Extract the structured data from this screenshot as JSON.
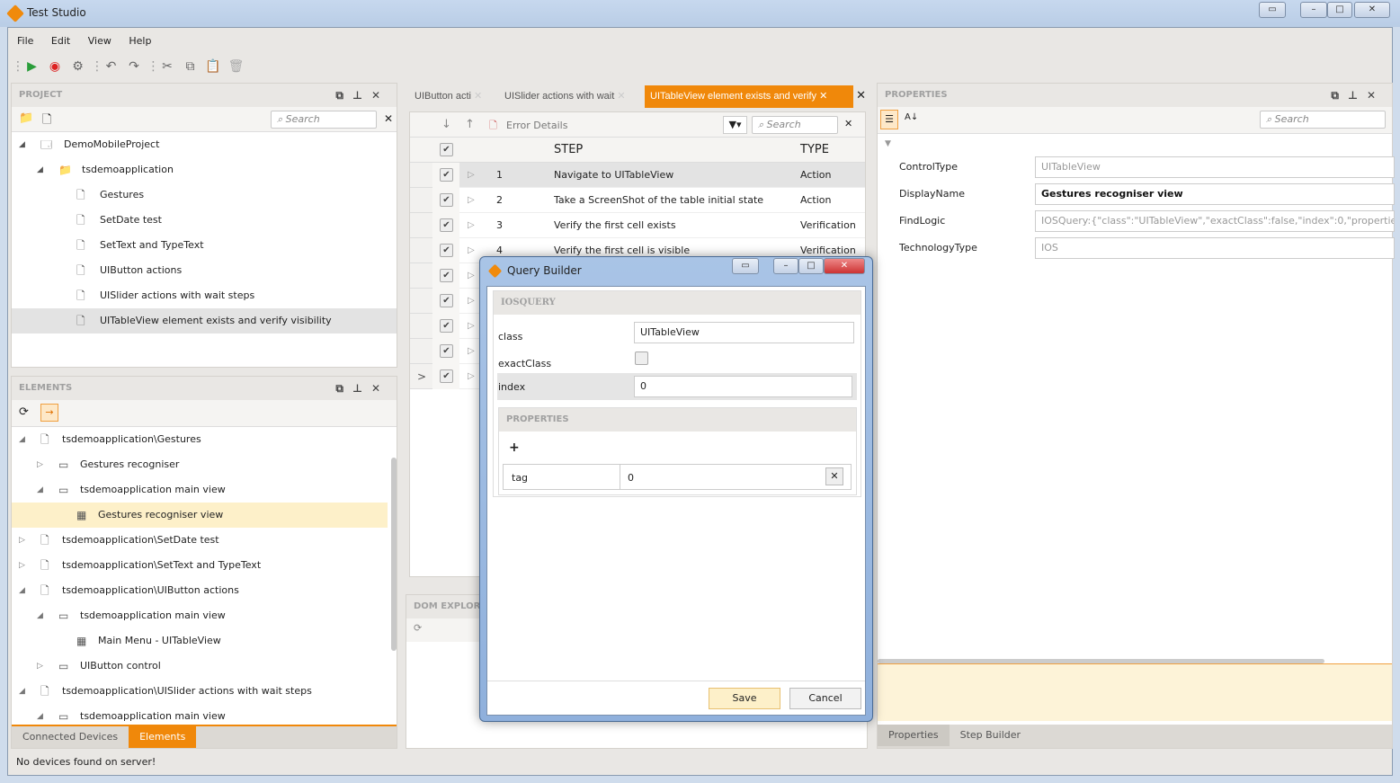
{
  "window": {
    "title": "Test Studio",
    "controls": [
      "restore-down",
      "minimize",
      "maximize",
      "close"
    ]
  },
  "menu": [
    "File",
    "Edit",
    "View",
    "Help"
  ],
  "toolbar": {
    "icons": [
      "run-icon",
      "record-icon",
      "settings-icon",
      "undo-icon",
      "redo-icon",
      "cut-icon",
      "copy-icon",
      "paste-icon",
      "delete-icon"
    ]
  },
  "project": {
    "title": "PROJECT",
    "search_placeholder": "Search",
    "items": [
      {
        "label": "DemoMobileProject",
        "level": 0,
        "icon": "project-icon",
        "expanded": true
      },
      {
        "label": "tsdemoapplication",
        "level": 1,
        "icon": "folder-icon",
        "expanded": true
      },
      {
        "label": "Gestures",
        "level": 2,
        "icon": "file-icon"
      },
      {
        "label": "SetDate test",
        "level": 2,
        "icon": "file-icon"
      },
      {
        "label": "SetText and TypeText",
        "level": 2,
        "icon": "file-icon"
      },
      {
        "label": "UIButton actions",
        "level": 2,
        "icon": "file-icon"
      },
      {
        "label": "UISlider actions with wait steps",
        "level": 2,
        "icon": "file-icon"
      },
      {
        "label": "UITableView element exists and verify visibility",
        "level": 2,
        "icon": "file-icon",
        "selected": true
      }
    ]
  },
  "elements": {
    "title": "ELEMENTS",
    "items": [
      {
        "label": "tsdemoapplication\\Gestures",
        "level": 0,
        "icon": "file-icon",
        "toggle": "expanded"
      },
      {
        "label": "Gestures recogniser",
        "level": 1,
        "icon": "window-icon",
        "toggle": "collapsed"
      },
      {
        "label": "tsdemoapplication main view",
        "level": 1,
        "icon": "window-icon",
        "toggle": "expanded"
      },
      {
        "label": "Gestures recogniser view",
        "level": 2,
        "icon": "table-icon",
        "highlighted": true
      },
      {
        "label": "tsdemoapplication\\SetDate test",
        "level": 0,
        "icon": "file-icon",
        "toggle": "collapsed"
      },
      {
        "label": "tsdemoapplication\\SetText and TypeText",
        "level": 0,
        "icon": "file-icon",
        "toggle": "collapsed"
      },
      {
        "label": "tsdemoapplication\\UIButton actions",
        "level": 0,
        "icon": "file-icon",
        "toggle": "expanded"
      },
      {
        "label": "tsdemoapplication main view",
        "level": 1,
        "icon": "window-icon",
        "toggle": "expanded"
      },
      {
        "label": "Main Menu - UITableView",
        "level": 2,
        "icon": "table-icon"
      },
      {
        "label": "UIButton control",
        "level": 1,
        "icon": "window-icon",
        "toggle": "collapsed"
      },
      {
        "label": "tsdemoapplication\\UISlider actions with wait steps",
        "level": 0,
        "icon": "file-icon",
        "toggle": "expanded"
      },
      {
        "label": "tsdemoapplication main view",
        "level": 1,
        "icon": "window-icon",
        "toggle": "expanded"
      }
    ],
    "bottom_tabs": [
      {
        "label": "Connected Devices"
      },
      {
        "label": "Elements",
        "active": true
      }
    ]
  },
  "editor": {
    "tabs": [
      {
        "label": "UIButton acti"
      },
      {
        "label": "UISlider actions with wait"
      },
      {
        "label": "UITableView element exists and verify",
        "active": true
      }
    ],
    "error_details": "Error Details",
    "search_placeholder": "Search",
    "columns": {
      "step": "STEP",
      "type": "TYPE"
    },
    "steps": [
      {
        "n": "1",
        "step": "Navigate to UITableView",
        "type": "Action"
      },
      {
        "n": "2",
        "step": "Take a ScreenShot of the table initial state",
        "type": "Action"
      },
      {
        "n": "3",
        "step": "Verify the first cell exists",
        "type": "Verification"
      },
      {
        "n": "4",
        "step": "Verify the first cell is visible",
        "type": "Verification"
      },
      {
        "n": "",
        "step": "",
        "type": ""
      },
      {
        "n": "",
        "step": "",
        "type": ""
      },
      {
        "n": "",
        "step": "",
        "type": ""
      },
      {
        "n": "",
        "step": "",
        "type": ""
      },
      {
        "n": "",
        "step": "",
        "type": ""
      }
    ]
  },
  "dom_explorer": {
    "title": "DOM EXPLORER"
  },
  "properties": {
    "title": "PROPERTIES",
    "search_placeholder": "Search",
    "rows": [
      {
        "name": "ControlType",
        "value": "UITableView"
      },
      {
        "name": "DisplayName",
        "value": "Gestures recogniser view",
        "editable": true
      },
      {
        "name": "FindLogic",
        "value": "IOSQuery:{\"class\":\"UITableView\",\"exactClass\":false,\"index\":0,\"properties"
      },
      {
        "name": "TechnologyType",
        "value": "IOS"
      }
    ],
    "bottom_tabs": [
      {
        "label": "Properties",
        "active": true
      },
      {
        "label": "Step Builder"
      }
    ]
  },
  "dialog": {
    "title": "Query Builder",
    "section": "IOSQUERY",
    "class_label": "class",
    "class_value": "UITableView",
    "exactclass_label": "exactClass",
    "exactclass_checked": false,
    "index_label": "index",
    "index_value": "0",
    "properties_section": "PROPERTIES",
    "add": "+",
    "prop_name": "tag",
    "prop_value": "0",
    "save": "Save",
    "cancel": "Cancel"
  },
  "status": "No devices found on server!",
  "colors": {
    "accent": "#f0880a",
    "highlight": "#fdf0c9"
  }
}
